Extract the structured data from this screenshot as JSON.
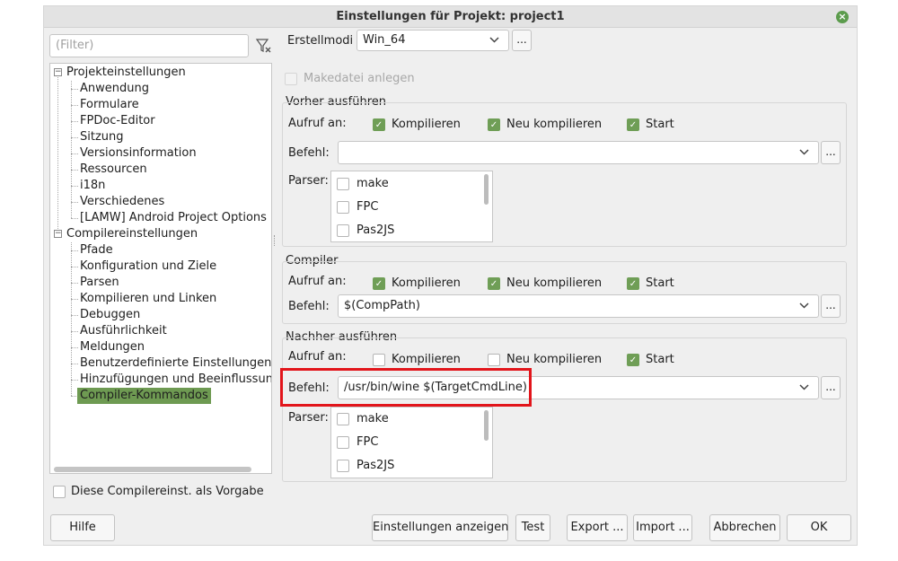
{
  "window": {
    "title": "Einstellungen für Projekt: project1",
    "close_icon": "close-icon",
    "accent_color": "#6f9e56",
    "highlight_color": "#e2151b"
  },
  "filter": {
    "placeholder": "(Filter)"
  },
  "tree": {
    "groups": [
      {
        "label": "Projekteinstellungen",
        "expanded": true,
        "items": [
          "Anwendung",
          "Formulare",
          "FPDoc-Editor",
          "Sitzung",
          "Versionsinformation",
          "Ressourcen",
          "i18n",
          "Verschiedenes",
          "[LAMW] Android Project Options"
        ]
      },
      {
        "label": "Compilereinstellungen",
        "expanded": true,
        "items": [
          "Pfade",
          "Konfiguration und Ziele",
          "Parsen",
          "Kompilieren und Linken",
          "Debuggen",
          "Ausführlichkeit",
          "Meldungen",
          "Benutzerdefinierte Einstellungen",
          "Hinzufügungen und Beeinflussungen",
          "Compiler-Kommandos"
        ]
      }
    ],
    "selected": "Compiler-Kommandos"
  },
  "default_checkbox": {
    "label": "Diese Compilereinst. als Vorgabe",
    "checked": false
  },
  "build_modes": {
    "label": "Erstellmodi",
    "value": "Win_64",
    "more": "..."
  },
  "makefile": {
    "label": "Makedatei anlegen",
    "checked": false,
    "disabled": true
  },
  "sections": {
    "before": {
      "title": "Vorher ausführen",
      "call_on_label": "Aufruf an:",
      "compile": {
        "label": "Kompilieren",
        "checked": true
      },
      "rebuild": {
        "label": "Neu kompilieren",
        "checked": true
      },
      "run": {
        "label": "Start",
        "checked": true
      },
      "command_label": "Befehl:",
      "command_value": "",
      "more": "...",
      "parser_label": "Parser:",
      "parsers": [
        {
          "label": "make",
          "checked": false
        },
        {
          "label": "FPC",
          "checked": false
        },
        {
          "label": "Pas2JS",
          "checked": false
        }
      ]
    },
    "compiler": {
      "title": "Compiler",
      "call_on_label": "Aufruf an:",
      "compile": {
        "label": "Kompilieren",
        "checked": true
      },
      "rebuild": {
        "label": "Neu kompilieren",
        "checked": true
      },
      "run": {
        "label": "Start",
        "checked": true
      },
      "command_label": "Befehl:",
      "command_value": "$(CompPath)",
      "more": "..."
    },
    "after": {
      "title": "Nachher ausführen",
      "call_on_label": "Aufruf an:",
      "compile": {
        "label": "Kompilieren",
        "checked": false
      },
      "rebuild": {
        "label": "Neu kompilieren",
        "checked": false
      },
      "run": {
        "label": "Start",
        "checked": true
      },
      "command_label": "Befehl:",
      "command_value": "/usr/bin/wine $(TargetCmdLine)",
      "more": "...",
      "parser_label": "Parser:",
      "parsers": [
        {
          "label": "make",
          "checked": false
        },
        {
          "label": "FPC",
          "checked": false
        },
        {
          "label": "Pas2JS",
          "checked": false
        }
      ]
    }
  },
  "buttons": {
    "help": "Hilfe",
    "show_options": "Einstellungen anzeigen",
    "test": "Test",
    "export": "Export ...",
    "import": "Import ...",
    "cancel": "Abbrechen",
    "ok": "OK"
  }
}
